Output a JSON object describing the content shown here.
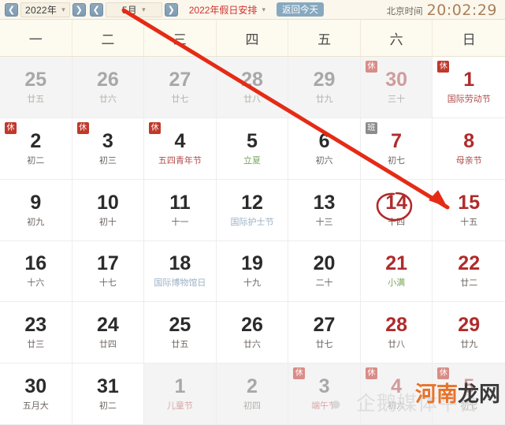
{
  "toolbar": {
    "prev_year_icon": "chevron-left-icon",
    "next_year_icon": "chevron-right-icon",
    "prev_month_icon": "chevron-left-icon",
    "next_month_icon": "chevron-right-icon",
    "year_value": "2022年",
    "month_value": "5月",
    "holiday_select_value": "2022年假日安排",
    "today_button": "返回今天",
    "clock_label": "北京时间",
    "clock_time": "20:02:29",
    "caret": "▾"
  },
  "weekdays": [
    "一",
    "二",
    "三",
    "四",
    "五",
    "六",
    "日"
  ],
  "colors": {
    "toolbar_bg": "#fbf7ec",
    "weekhead_bg": "#fdfaef",
    "holiday_red": "#d0312d",
    "weekend_red": "#b02b2b",
    "rest_badge": "#c0392b",
    "work_badge": "#8c8c8c",
    "solar_term_green": "#7aa55c",
    "intl_day_blue": "#9bb0c6",
    "clock_brown": "#a9805c",
    "today_button_blue": "#87a9c0",
    "annotation_red": "#e52b15"
  },
  "badges": {
    "rest": "休",
    "work": "班"
  },
  "days": [
    {
      "num": "25",
      "sub": "廿五",
      "other": true,
      "weekend": false,
      "badge": "",
      "subtype": ""
    },
    {
      "num": "26",
      "sub": "廿六",
      "other": true,
      "weekend": false,
      "badge": "",
      "subtype": ""
    },
    {
      "num": "27",
      "sub": "廿七",
      "other": true,
      "weekend": false,
      "badge": "",
      "subtype": ""
    },
    {
      "num": "28",
      "sub": "廿八",
      "other": true,
      "weekend": false,
      "badge": "",
      "subtype": ""
    },
    {
      "num": "29",
      "sub": "廿九",
      "other": true,
      "weekend": false,
      "badge": "",
      "subtype": ""
    },
    {
      "num": "30",
      "sub": "三十",
      "other": true,
      "weekend": true,
      "badge": "rest",
      "subtype": ""
    },
    {
      "num": "1",
      "sub": "国际劳动节",
      "other": false,
      "weekend": true,
      "badge": "rest",
      "subtype": "fest"
    },
    {
      "num": "2",
      "sub": "初二",
      "other": false,
      "weekend": false,
      "badge": "rest",
      "subtype": ""
    },
    {
      "num": "3",
      "sub": "初三",
      "other": false,
      "weekend": false,
      "badge": "rest",
      "subtype": ""
    },
    {
      "num": "4",
      "sub": "五四青年节",
      "other": false,
      "weekend": false,
      "badge": "rest",
      "subtype": "fest"
    },
    {
      "num": "5",
      "sub": "立夏",
      "other": false,
      "weekend": false,
      "badge": "",
      "subtype": "term"
    },
    {
      "num": "6",
      "sub": "初六",
      "other": false,
      "weekend": false,
      "badge": "",
      "subtype": ""
    },
    {
      "num": "7",
      "sub": "初七",
      "other": false,
      "weekend": true,
      "badge": "work",
      "subtype": ""
    },
    {
      "num": "8",
      "sub": "母亲节",
      "other": false,
      "weekend": true,
      "badge": "",
      "subtype": "fest"
    },
    {
      "num": "9",
      "sub": "初九",
      "other": false,
      "weekend": false,
      "badge": "",
      "subtype": ""
    },
    {
      "num": "10",
      "sub": "初十",
      "other": false,
      "weekend": false,
      "badge": "",
      "subtype": ""
    },
    {
      "num": "11",
      "sub": "十一",
      "other": false,
      "weekend": false,
      "badge": "",
      "subtype": ""
    },
    {
      "num": "12",
      "sub": "国际护士节",
      "other": false,
      "weekend": false,
      "badge": "",
      "subtype": "intl"
    },
    {
      "num": "13",
      "sub": "十三",
      "other": false,
      "weekend": false,
      "badge": "",
      "subtype": ""
    },
    {
      "num": "14",
      "sub": "十四",
      "other": false,
      "weekend": true,
      "badge": "",
      "subtype": ""
    },
    {
      "num": "15",
      "sub": "十五",
      "other": false,
      "weekend": true,
      "badge": "",
      "subtype": ""
    },
    {
      "num": "16",
      "sub": "十六",
      "other": false,
      "weekend": false,
      "badge": "",
      "subtype": ""
    },
    {
      "num": "17",
      "sub": "十七",
      "other": false,
      "weekend": false,
      "badge": "",
      "subtype": ""
    },
    {
      "num": "18",
      "sub": "国际博物馆日",
      "other": false,
      "weekend": false,
      "badge": "",
      "subtype": "intl"
    },
    {
      "num": "19",
      "sub": "十九",
      "other": false,
      "weekend": false,
      "badge": "",
      "subtype": ""
    },
    {
      "num": "20",
      "sub": "二十",
      "other": false,
      "weekend": false,
      "badge": "",
      "subtype": ""
    },
    {
      "num": "21",
      "sub": "小满",
      "other": false,
      "weekend": true,
      "badge": "",
      "subtype": "term"
    },
    {
      "num": "22",
      "sub": "廿二",
      "other": false,
      "weekend": true,
      "badge": "",
      "subtype": ""
    },
    {
      "num": "23",
      "sub": "廿三",
      "other": false,
      "weekend": false,
      "badge": "",
      "subtype": ""
    },
    {
      "num": "24",
      "sub": "廿四",
      "other": false,
      "weekend": false,
      "badge": "",
      "subtype": ""
    },
    {
      "num": "25",
      "sub": "廿五",
      "other": false,
      "weekend": false,
      "badge": "",
      "subtype": ""
    },
    {
      "num": "26",
      "sub": "廿六",
      "other": false,
      "weekend": false,
      "badge": "",
      "subtype": ""
    },
    {
      "num": "27",
      "sub": "廿七",
      "other": false,
      "weekend": false,
      "badge": "",
      "subtype": ""
    },
    {
      "num": "28",
      "sub": "廿八",
      "other": false,
      "weekend": true,
      "badge": "",
      "subtype": ""
    },
    {
      "num": "29",
      "sub": "廿九",
      "other": false,
      "weekend": true,
      "badge": "",
      "subtype": ""
    },
    {
      "num": "30",
      "sub": "五月大",
      "other": false,
      "weekend": false,
      "badge": "",
      "subtype": ""
    },
    {
      "num": "31",
      "sub": "初二",
      "other": false,
      "weekend": false,
      "badge": "",
      "subtype": ""
    },
    {
      "num": "1",
      "sub": "儿童节",
      "other": true,
      "weekend": false,
      "badge": "",
      "subtype": "fest"
    },
    {
      "num": "2",
      "sub": "初四",
      "other": true,
      "weekend": false,
      "badge": "",
      "subtype": ""
    },
    {
      "num": "3",
      "sub": "端午节",
      "other": true,
      "weekend": false,
      "badge": "rest",
      "subtype": "fest"
    },
    {
      "num": "4",
      "sub": "初六",
      "other": true,
      "weekend": true,
      "badge": "rest",
      "subtype": ""
    },
    {
      "num": "5",
      "sub": "初七",
      "other": true,
      "weekend": true,
      "badge": "rest",
      "subtype": ""
    }
  ],
  "annotations": {
    "circled_day": "14",
    "arrow_target_day": "15",
    "stroke_color": "#e52b15"
  },
  "watermarks": {
    "penguin_icon": "penguin-icon",
    "platform_text": "企鹅媒体平台",
    "site_text_primary": "河南",
    "site_text_secondary": "龙网"
  }
}
